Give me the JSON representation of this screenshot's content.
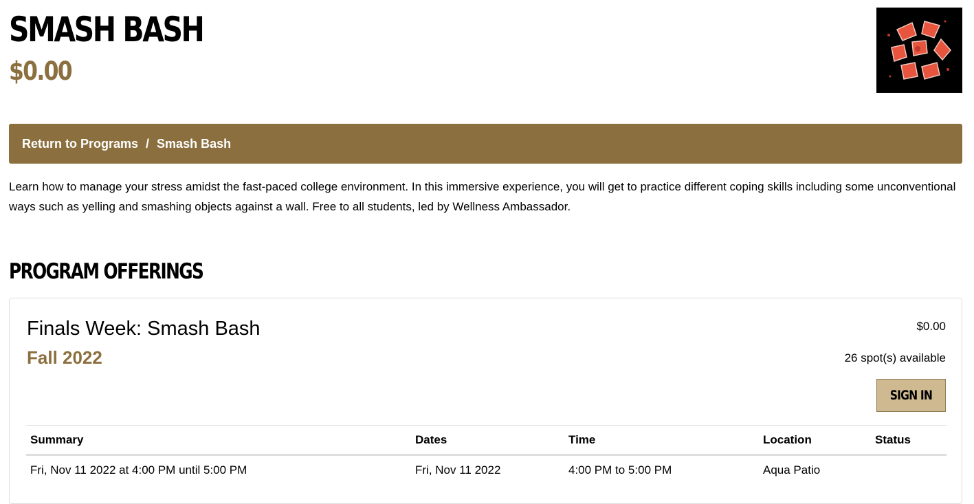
{
  "header": {
    "title": "SMASH BASH",
    "price": "$0.00",
    "image_icon": "smashed-plates-image"
  },
  "breadcrumb": {
    "back_label": "Return to Programs",
    "separator": "/",
    "current": "Smash Bash"
  },
  "description": "Learn how to manage your stress amidst the fast-paced college environment. In this immersive experience, you will get to practice different coping skills including some unconventional ways such as yelling and smashing objects against a wall. Free to all students, led by Wellness Ambassador.",
  "offerings": {
    "section_title": "PROGRAM OFFERINGS",
    "card": {
      "name": "Finals Week: Smash Bash",
      "term": "Fall 2022",
      "price": "$0.00",
      "spots": "26 spot(s) available",
      "sign_in_label": "SIGN IN",
      "table": {
        "headers": [
          "Summary",
          "Dates",
          "Time",
          "Location",
          "Status"
        ],
        "rows": [
          [
            "Fri, Nov 11 2022 at 4:00 PM until 5:00 PM",
            "Fri, Nov 11 2022",
            "4:00 PM to 5:00 PM",
            "Aqua Patio",
            ""
          ]
        ]
      }
    }
  },
  "colors": {
    "accent_gold": "#8b6f3e",
    "button_gold": "#cfb991",
    "text": "#000000",
    "border": "#dedede"
  }
}
